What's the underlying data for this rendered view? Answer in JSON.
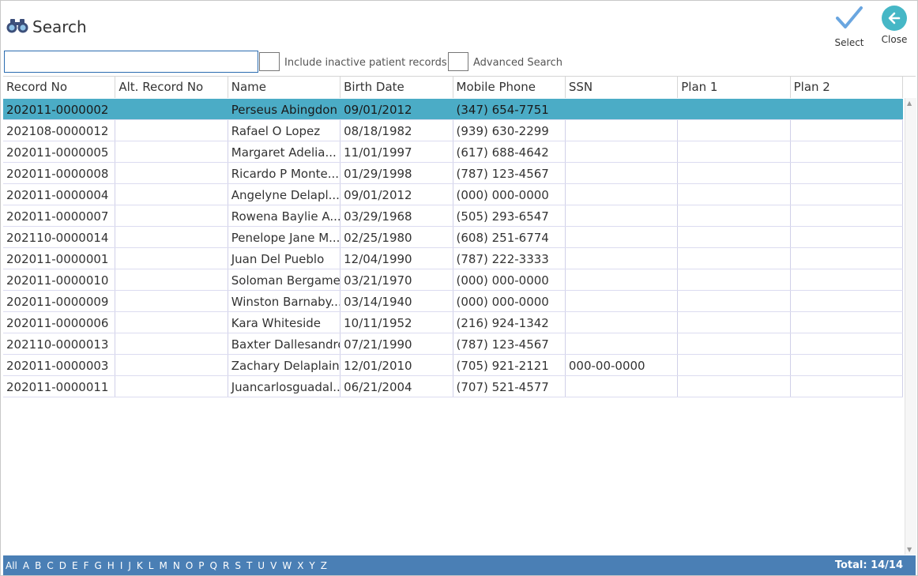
{
  "header": {
    "title": "Search",
    "select_label": "Select",
    "close_label": "Close"
  },
  "search": {
    "value": "",
    "placeholder": "",
    "include_inactive_label": "Include inactive patient records.",
    "advanced_search_label": "Advanced Search"
  },
  "grid": {
    "columns": [
      "Record No",
      "Alt. Record No",
      "Name",
      "Birth Date",
      "Mobile Phone",
      "SSN",
      "Plan 1",
      "Plan 2"
    ],
    "rows": [
      [
        "202011-0000002",
        "",
        "Perseus Abingdon",
        "09/01/2012",
        "(347) 654-7751",
        "",
        "",
        ""
      ],
      [
        "202108-0000012",
        "",
        "Rafael O Lopez",
        "08/18/1982",
        "(939) 630-2299",
        "",
        "",
        ""
      ],
      [
        "202011-0000005",
        "",
        "Margaret Adelia...",
        "11/01/1997",
        "(617) 688-4642",
        "",
        "",
        ""
      ],
      [
        "202011-0000008",
        "",
        "Ricardo P Monte...",
        "01/29/1998",
        "(787) 123-4567",
        "",
        "",
        ""
      ],
      [
        "202011-0000004",
        "",
        "Angelyne Delapl...",
        "09/01/2012",
        "(000) 000-0000",
        "",
        "",
        ""
      ],
      [
        "202011-0000007",
        "",
        "Rowena Baylie A...",
        "03/29/1968",
        "(505) 293-6547",
        "",
        "",
        ""
      ],
      [
        "202110-0000014",
        "",
        "Penelope Jane M...",
        "02/25/1980",
        "(608) 251-6774",
        "",
        "",
        ""
      ],
      [
        "202011-0000001",
        "",
        "Juan Del Pueblo",
        "12/04/1990",
        "(787) 222-3333",
        "",
        "",
        ""
      ],
      [
        "202011-0000010",
        "",
        "Soloman Bergamel",
        "03/21/1970",
        "(000) 000-0000",
        "",
        "",
        ""
      ],
      [
        "202011-0000009",
        "",
        "Winston Barnaby...",
        "03/14/1940",
        "(000) 000-0000",
        "",
        "",
        ""
      ],
      [
        "202011-0000006",
        "",
        "Kara Whiteside",
        "10/11/1952",
        "(216) 924-1342",
        "",
        "",
        ""
      ],
      [
        "202110-0000013",
        "",
        "Baxter Dallesandro",
        "07/21/1990",
        "(787) 123-4567",
        "",
        "",
        ""
      ],
      [
        "202011-0000003",
        "",
        "Zachary Delaplaine",
        "12/01/2010",
        "(705) 921-2121",
        "000-00-0000",
        "",
        ""
      ],
      [
        "202011-0000011",
        "",
        "Juancarlosguadal...",
        "06/21/2004",
        "(707) 521-4577",
        "",
        "",
        ""
      ]
    ],
    "selected_row": 0
  },
  "footer": {
    "letters": [
      "All",
      "A",
      "B",
      "C",
      "D",
      "E",
      "F",
      "G",
      "H",
      "I",
      "J",
      "K",
      "L",
      "M",
      "N",
      "O",
      "P",
      "Q",
      "R",
      "S",
      "T",
      "U",
      "V",
      "W",
      "X",
      "Y",
      "Z"
    ],
    "total": "Total: 14/14"
  },
  "colors": {
    "selected_row": "#4bacc6",
    "footer_bar": "#4a7fb5",
    "close_button": "#46b7c6",
    "select_check": "#6aa6e0"
  },
  "icons": {
    "title_icon": "binoculars-icon",
    "select_icon": "checkmark-icon",
    "close_icon": "arrow-left-icon"
  }
}
